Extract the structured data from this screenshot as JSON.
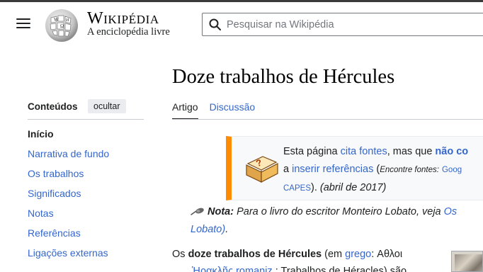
{
  "header": {
    "menu_icon": "hamburger-menu-icon",
    "logo_icon": "wikipedia-globe-icon",
    "wordmark": "Wikipédia",
    "tagline": "A enciclopédia livre",
    "search": {
      "placeholder": "Pesquisar na Wikipédia",
      "value": ""
    }
  },
  "page": {
    "title": "Doze trabalhos de Hércules",
    "tabs": [
      {
        "label": "Artigo",
        "active": true
      },
      {
        "label": "Discussão",
        "active": false
      }
    ]
  },
  "toc": {
    "heading": "Conteúdos",
    "hide_label": "ocultar",
    "items": [
      {
        "label": "Início",
        "current": true
      },
      {
        "label": "Narrativa de fundo"
      },
      {
        "label": "Os trabalhos"
      },
      {
        "label": "Significados"
      },
      {
        "label": "Notas"
      },
      {
        "label": "Referências"
      },
      {
        "label": "Ligações externas"
      }
    ]
  },
  "notice": {
    "icon": "book-question-icon",
    "accent_color": "#ff8c00",
    "p1": "Esta página ",
    "link1": "cita fontes",
    "p2": ", mas que ",
    "link2": "não co",
    "p3": "a ",
    "link3": "inserir referências",
    "p4": " (",
    "find_label": "Encontre fontes:",
    "link4": "Goog",
    "link5": "CAPES",
    "p5": "). ",
    "date": "(abril de 2017)"
  },
  "hatnote": {
    "icon": "pin-icon",
    "label": "Nota:",
    "text": " Para o livro do escritor Monteiro Lobato, veja ",
    "link": "Os",
    "link2": "Lobato)",
    "end": "."
  },
  "lead": {
    "t1": "Os ",
    "bold": "doze trabalhos de Hércules",
    "t2": " (em ",
    "link1": "grego",
    "t3": ": Αθλοι",
    "line2_link": "Ἡρακλῆς romaniz.",
    "line2_text": ": Trabalhos de Héracles) são"
  },
  "colors": {
    "link": "#3366cc",
    "text": "#202122",
    "border": "#c8ccd1"
  }
}
